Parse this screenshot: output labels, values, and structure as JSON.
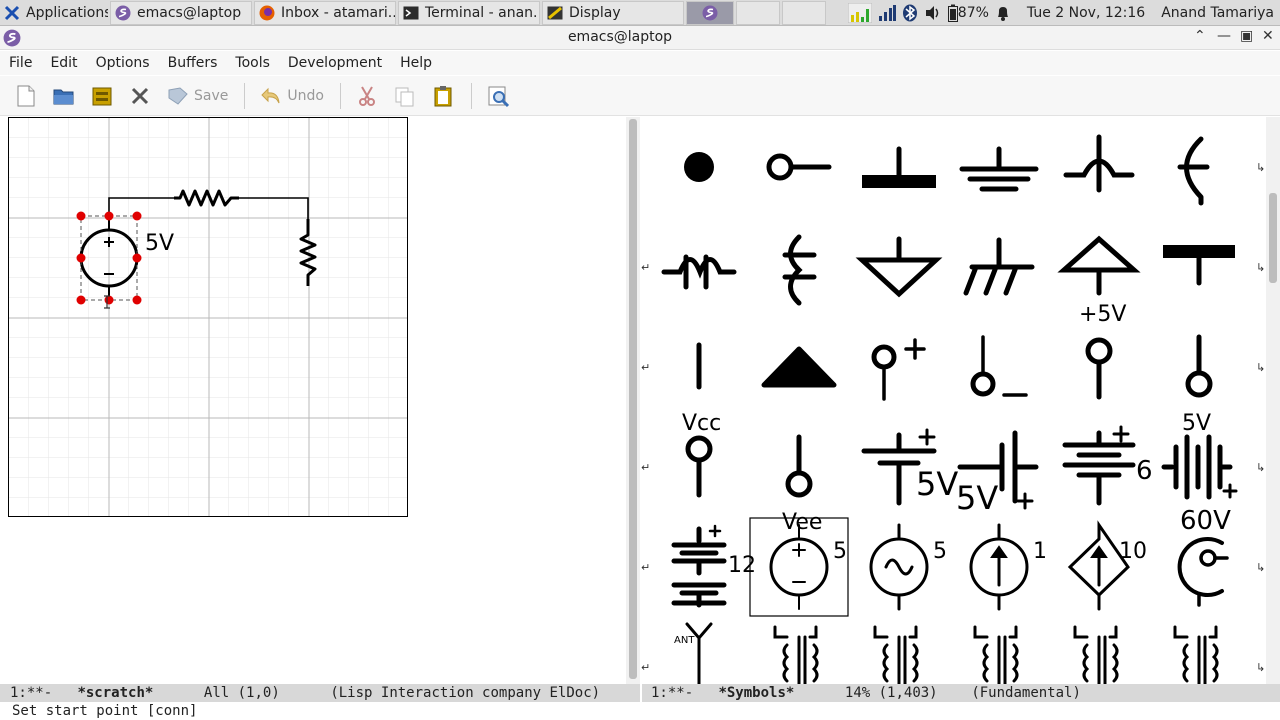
{
  "taskbar": {
    "apps_label": "Applications",
    "tasks": [
      {
        "label": "emacs@laptop"
      },
      {
        "label": "Inbox - atamari..."
      },
      {
        "label": "Terminal - anan..."
      },
      {
        "label": "Display"
      }
    ],
    "battery": "87%",
    "clock": "Tue  2 Nov, 12:16",
    "user": "Anand Tamariya"
  },
  "window": {
    "title": "emacs@laptop"
  },
  "menu": [
    "File",
    "Edit",
    "Options",
    "Buffers",
    "Tools",
    "Development",
    "Help"
  ],
  "toolbar": {
    "save_label": "Save",
    "undo_label": "Undo"
  },
  "drawing": {
    "voltage_label": "5V"
  },
  "palette": {
    "labels": {
      "partial_5v_top": "+5V",
      "vcc_cut": "Vcc",
      "fivev_cut": "5V",
      "vee_cut": "Vee",
      "battery_5v_right": "5V",
      "battery_5v_left": "5V",
      "battery_6": "6",
      "battery_60v": "60V",
      "battery_12": "12",
      "dc_source_value": "5",
      "ac_source_value": "5",
      "current_source_value": "1",
      "dep_source_value": "10",
      "antenna_label": "ANT"
    }
  },
  "modeline_left": {
    "status": "1:**-",
    "buffer": "*scratch*",
    "position": "All (1,0)",
    "modes": "(Lisp Interaction company ElDoc)"
  },
  "modeline_right": {
    "status": "1:**-",
    "buffer": "*Symbols*",
    "position": "14% (1,403)",
    "modes": "(Fundamental)"
  },
  "echo": "Set start point [conn]",
  "colors": {
    "selection_handle": "#e00000",
    "taskbar": "#dcdcdc"
  }
}
